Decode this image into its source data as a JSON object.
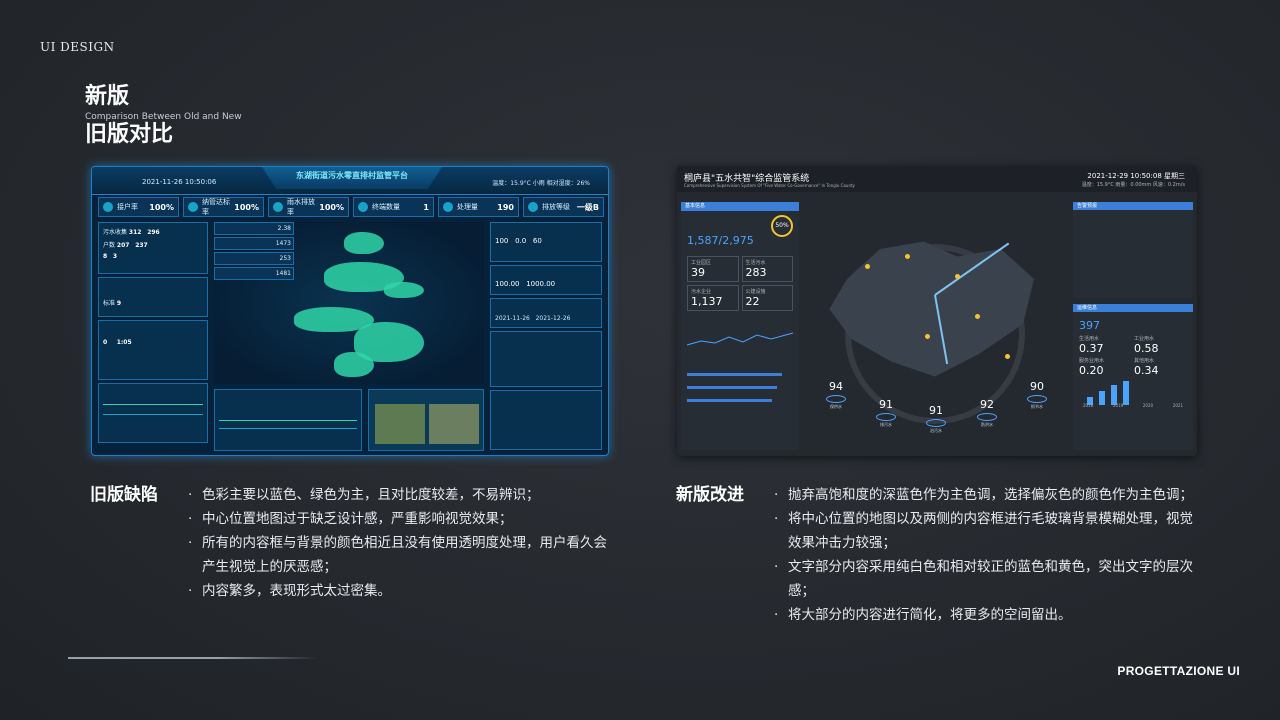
{
  "brand": "UI DESIGN",
  "title": {
    "line1": "新版",
    "en": "Comparison Between Old and New",
    "line2": "旧版对比"
  },
  "old_panel": {
    "date": "2021-11-26 10:50:06",
    "title": "东湖街道污水零直排村监管平台",
    "weather": "温度：15.9°C   小雨   相对湿度：26%",
    "stats": [
      {
        "label": "接户率",
        "value": "100%"
      },
      {
        "label": "纳管达标率",
        "value": "100%"
      },
      {
        "label": "雨水排放率",
        "value": "100%"
      },
      {
        "label": "终端数量",
        "value": "1"
      },
      {
        "label": "处理量",
        "value": "190"
      },
      {
        "label": "排放等级",
        "value": "一级B"
      }
    ],
    "left_values": [
      "312",
      "296",
      "207",
      "237",
      "8",
      "3",
      "9",
      "0",
      "1:05"
    ],
    "right_values": [
      "100",
      "0.0",
      "60",
      "100.00",
      "1000.00",
      "2021-11-26",
      "2021-12-26"
    ],
    "mid_values": [
      "2.38",
      "1473",
      "253",
      "1481"
    ]
  },
  "new_panel": {
    "title": "桐庐县\"五水共智\"综合监管系统",
    "title_en": "Comprehensive Supervision System Of \"Five Water Co-Governance\" In Tonglu County",
    "date": "2021-12-29 10:50:08  星期三",
    "weather": "温度：15.9°C  雨量：0.00mm  风速：0.2m/s",
    "left_header": "基本信息",
    "pipe_ratio": "1,587/2,975",
    "pipe_pct": "50%",
    "grid": [
      {
        "label": "工业园区",
        "value": "39"
      },
      {
        "label": "生活污水",
        "value": "283"
      },
      {
        "label": "污水企业",
        "value": "1,137"
      },
      {
        "label": "公建设施",
        "value": "22"
      }
    ],
    "right_header1": "告警预报",
    "right_header2": "运维信息",
    "right_total": "397",
    "right_grid": [
      {
        "label": "生活用水",
        "value": "0.37"
      },
      {
        "label": "工业用水",
        "value": "0.58"
      },
      {
        "label": "服务业用水",
        "value": "0.20"
      },
      {
        "label": "其他用水",
        "value": "0.34"
      }
    ],
    "year_labels": [
      "2018",
      "2019",
      "2020",
      "2021"
    ],
    "kpis": [
      {
        "value": "94",
        "label": "保供水"
      },
      {
        "value": "91",
        "label": "排污水"
      },
      {
        "value": "91",
        "label": "治污水"
      },
      {
        "value": "92",
        "label": "防洪水"
      },
      {
        "value": "90",
        "label": "抓节水"
      }
    ]
  },
  "old_section": {
    "title": "旧版缺陷",
    "bullets": [
      "色彩主要以蓝色、绿色为主，且对比度较差，不易辨识；",
      "中心位置地图过于缺乏设计感，严重影响视觉效果；",
      "所有的内容框与背景的颜色相近且没有使用透明度处理，用户看久会产生视觉上的厌恶感；",
      "内容繁多，表现形式太过密集。"
    ]
  },
  "new_section": {
    "title": "新版改进",
    "bullets": [
      "抛弃高饱和度的深蓝色作为主色调，选择偏灰色的颜色作为主色调；",
      "将中心位置的地图以及两侧的内容框进行毛玻璃背景模糊处理，视觉效果冲击力较强；",
      "文字部分内容采用纯白色和相对较正的蓝色和黄色，突出文字的层次感；",
      "将大部分的内容进行简化，将更多的空间留出。"
    ]
  },
  "footer": "PROGETTAZIONE UI",
  "colors": {
    "accent_blue": "#4aa3ff",
    "accent_yellow": "#f4c430",
    "old_green": "#2fd6a8"
  }
}
